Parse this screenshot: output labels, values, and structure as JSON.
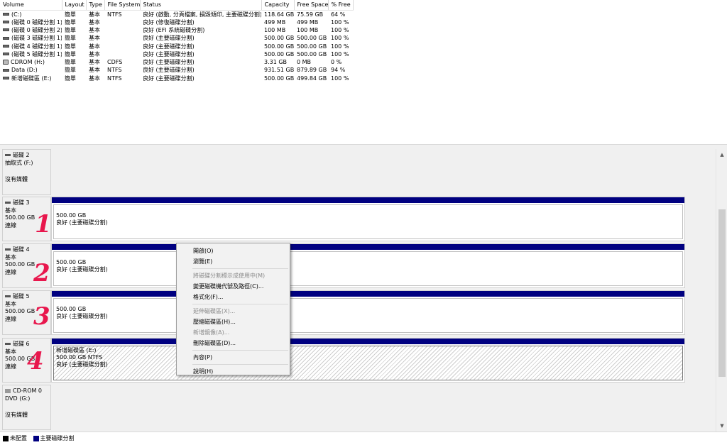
{
  "volume_list": {
    "columns": [
      "Volume",
      "Layout",
      "Type",
      "File System",
      "Status",
      "Capacity",
      "Free Space",
      "% Free"
    ],
    "rows": [
      {
        "icon": "drive-icon",
        "volume": "(C:)",
        "layout": "簡單",
        "type": "基本",
        "fs": "NTFS",
        "status": "良好 (啟動, 分頁檔案, 損毀傾印, 主要磁碟分割)",
        "capacity": "118.64 GB",
        "free": "75.59 GB",
        "pct": "64 %"
      },
      {
        "icon": "drive-icon",
        "volume": "(磁碟 0 磁碟分割 1)",
        "layout": "簡單",
        "type": "基本",
        "fs": "",
        "status": "良好 (修復磁碟分割)",
        "capacity": "499 MB",
        "free": "499 MB",
        "pct": "100 %"
      },
      {
        "icon": "drive-icon",
        "volume": "(磁碟 0 磁碟分割 2)",
        "layout": "簡單",
        "type": "基本",
        "fs": "",
        "status": "良好 (EFI 系統磁碟分割)",
        "capacity": "100 MB",
        "free": "100 MB",
        "pct": "100 %"
      },
      {
        "icon": "drive-icon",
        "volume": "(磁碟 3 磁碟分割 1)",
        "layout": "簡單",
        "type": "基本",
        "fs": "",
        "status": "良好 (主要磁碟分割)",
        "capacity": "500.00 GB",
        "free": "500.00 GB",
        "pct": "100 %"
      },
      {
        "icon": "drive-icon",
        "volume": "(磁碟 4 磁碟分割 1)",
        "layout": "簡單",
        "type": "基本",
        "fs": "",
        "status": "良好 (主要磁碟分割)",
        "capacity": "500.00 GB",
        "free": "500.00 GB",
        "pct": "100 %"
      },
      {
        "icon": "drive-icon",
        "volume": "(磁碟 5 磁碟分割 1)",
        "layout": "簡單",
        "type": "基本",
        "fs": "",
        "status": "良好 (主要磁碟分割)",
        "capacity": "500.00 GB",
        "free": "500.00 GB",
        "pct": "100 %"
      },
      {
        "icon": "cdrom-icon",
        "volume": "CDROM (H:)",
        "layout": "簡單",
        "type": "基本",
        "fs": "CDFS",
        "status": "良好 (主要磁碟分割)",
        "capacity": "3.31 GB",
        "free": "0 MB",
        "pct": "0 %"
      },
      {
        "icon": "drive-icon",
        "volume": "Data (D:)",
        "layout": "簡單",
        "type": "基本",
        "fs": "NTFS",
        "status": "良好 (主要磁碟分割)",
        "capacity": "931.51 GB",
        "free": "879.89 GB",
        "pct": "94 %"
      },
      {
        "icon": "drive-icon",
        "volume": "新增磁碟區 (E:)",
        "layout": "簡單",
        "type": "基本",
        "fs": "NTFS",
        "status": "良好 (主要磁碟分割)",
        "capacity": "500.00 GB",
        "free": "499.84 GB",
        "pct": "100 %"
      }
    ]
  },
  "disks": {
    "disk2": {
      "name": "磁碟 2",
      "line2": "抽取式 (F:)",
      "line3": "",
      "line4": "沒有媒體"
    },
    "disk3": {
      "name": "磁碟 3",
      "line2": "基本",
      "line3": "500.00 GB",
      "line4": "連線",
      "part": {
        "line1": "",
        "line2": "500.00 GB",
        "line3": "良好 (主要磁碟分割)"
      },
      "annotation": "1"
    },
    "disk4": {
      "name": "磁碟 4",
      "line2": "基本",
      "line3": "500.00 GB",
      "line4": "連線",
      "part": {
        "line1": "",
        "line2": "500.00 GB",
        "line3": "良好 (主要磁碟分割)"
      },
      "annotation": "2"
    },
    "disk5": {
      "name": "磁碟 5",
      "line2": "基本",
      "line3": "500.00 GB",
      "line4": "連線",
      "part": {
        "line1": "",
        "line2": "500.00 GB",
        "line3": "良好 (主要磁碟分割)"
      },
      "annotation": "3"
    },
    "disk6": {
      "name": "磁碟 6",
      "line2": "基本",
      "line3": "500.00 GB",
      "line4": "連線",
      "part": {
        "line1": "新增磁碟區 (E:)",
        "line2": "500.00 GB NTFS",
        "line3": "良好 (主要磁碟分割)"
      },
      "annotation": "4"
    },
    "cdrom0": {
      "name": "CD-ROM 0",
      "line2": "DVD (G:)",
      "line3": "",
      "line4": "沒有媒體"
    }
  },
  "legend": [
    {
      "label": "未配置",
      "color": "#000000"
    },
    {
      "label": "主要磁碟分割",
      "color": "#000080"
    }
  ],
  "context_menu": {
    "items": [
      {
        "label": "開啟(O)",
        "enabled": true
      },
      {
        "label": "瀏覽(E)",
        "enabled": true
      },
      {
        "sep": true
      },
      {
        "label": "將磁碟分割標示成使用中(M)",
        "enabled": false
      },
      {
        "label": "變更磁碟機代號及路徑(C)...",
        "enabled": true
      },
      {
        "label": "格式化(F)...",
        "enabled": true
      },
      {
        "sep": true
      },
      {
        "label": "延伸磁碟區(X)...",
        "enabled": false
      },
      {
        "label": "壓縮磁碟區(H)...",
        "enabled": true
      },
      {
        "label": "新增鏡像(A)...",
        "enabled": false
      },
      {
        "label": "刪除磁碟區(D)...",
        "enabled": true
      },
      {
        "sep": true
      },
      {
        "label": "內容(P)",
        "enabled": true
      },
      {
        "sep": true
      },
      {
        "label": "說明(H)",
        "enabled": true
      }
    ]
  },
  "colors": {
    "primary_partition": "#000080",
    "unallocated": "#000000",
    "annotation": "#e8174d"
  }
}
